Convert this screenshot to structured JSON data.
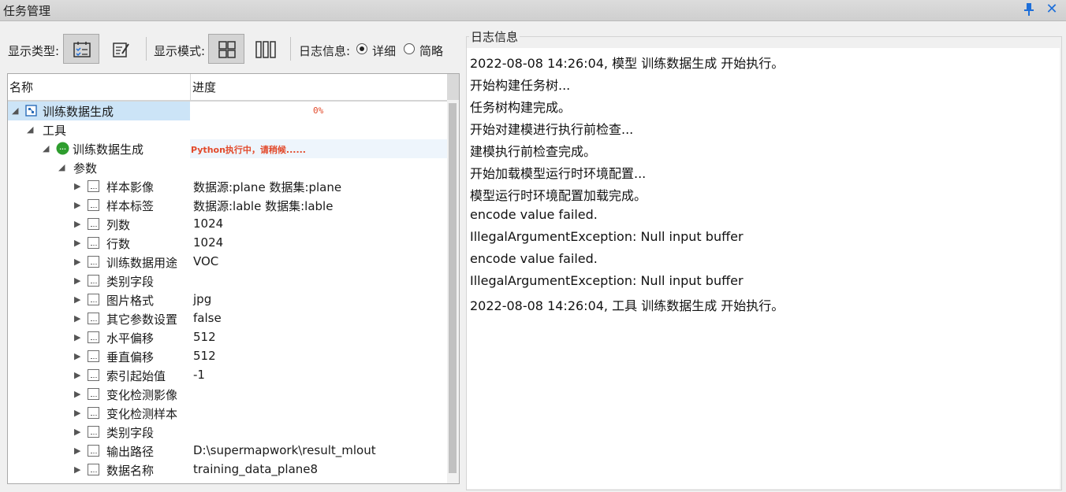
{
  "window": {
    "title": "任务管理",
    "pin_icon": "pin-icon",
    "close_icon": "close-icon"
  },
  "toolbar": {
    "display_type_label": "显示类型:",
    "display_mode_label": "显示模式:",
    "log_info_label": "日志信息:",
    "radio_detail": "详细",
    "radio_brief": "简略",
    "selected_log_mode": "详细"
  },
  "grid": {
    "columns": [
      "名称",
      "进度"
    ],
    "rows": [
      {
        "name": "训练数据生成",
        "value": "0%"
      },
      {
        "name": "工具",
        "value": ""
      },
      {
        "name": "训练数据生成",
        "value": "Python执行中，请稍候......"
      },
      {
        "name": "参数",
        "value": ""
      },
      {
        "name": "样本影像",
        "value": "数据源:plane 数据集:plane"
      },
      {
        "name": "样本标签",
        "value": "数据源:lable 数据集:lable"
      },
      {
        "name": "列数",
        "value": "1024"
      },
      {
        "name": "行数",
        "value": "1024"
      },
      {
        "name": "训练数据用途",
        "value": "VOC"
      },
      {
        "name": "类别字段",
        "value": ""
      },
      {
        "name": "图片格式",
        "value": "jpg"
      },
      {
        "name": "其它参数设置",
        "value": "false"
      },
      {
        "name": "水平偏移",
        "value": "512"
      },
      {
        "name": "垂直偏移",
        "value": "512"
      },
      {
        "name": "索引起始值",
        "value": "-1"
      },
      {
        "name": "变化检测影像",
        "value": ""
      },
      {
        "name": "变化检测样本",
        "value": ""
      },
      {
        "name": "类别字段",
        "value": ""
      },
      {
        "name": "输出路径",
        "value": "D:\\supermapwork\\result_mlout"
      },
      {
        "name": "数据名称",
        "value": "training_data_plane8"
      }
    ]
  },
  "log": {
    "legend": "日志信息",
    "lines": [
      "2022-08-08 14:26:04,  模型 训练数据生成 开始执行。",
      "开始构建任务树...",
      "任务树构建完成。",
      "开始对建模进行执行前检查...",
      "建模执行前检查完成。",
      "开始加载模型运行时环境配置...",
      "模型运行时环境配置加载完成。",
      "encode value failed.",
      "IllegalArgumentException: Null input buffer",
      "encode value failed.",
      "IllegalArgumentException: Null input buffer",
      "2022-08-08 14:26:04,  工具 训练数据生成 开始执行。"
    ]
  },
  "colors": {
    "accent": "#1e6fd9",
    "progress_text": "#e24a2b",
    "selection": "#cce4f7",
    "running_icon": "#2e9d2e"
  }
}
